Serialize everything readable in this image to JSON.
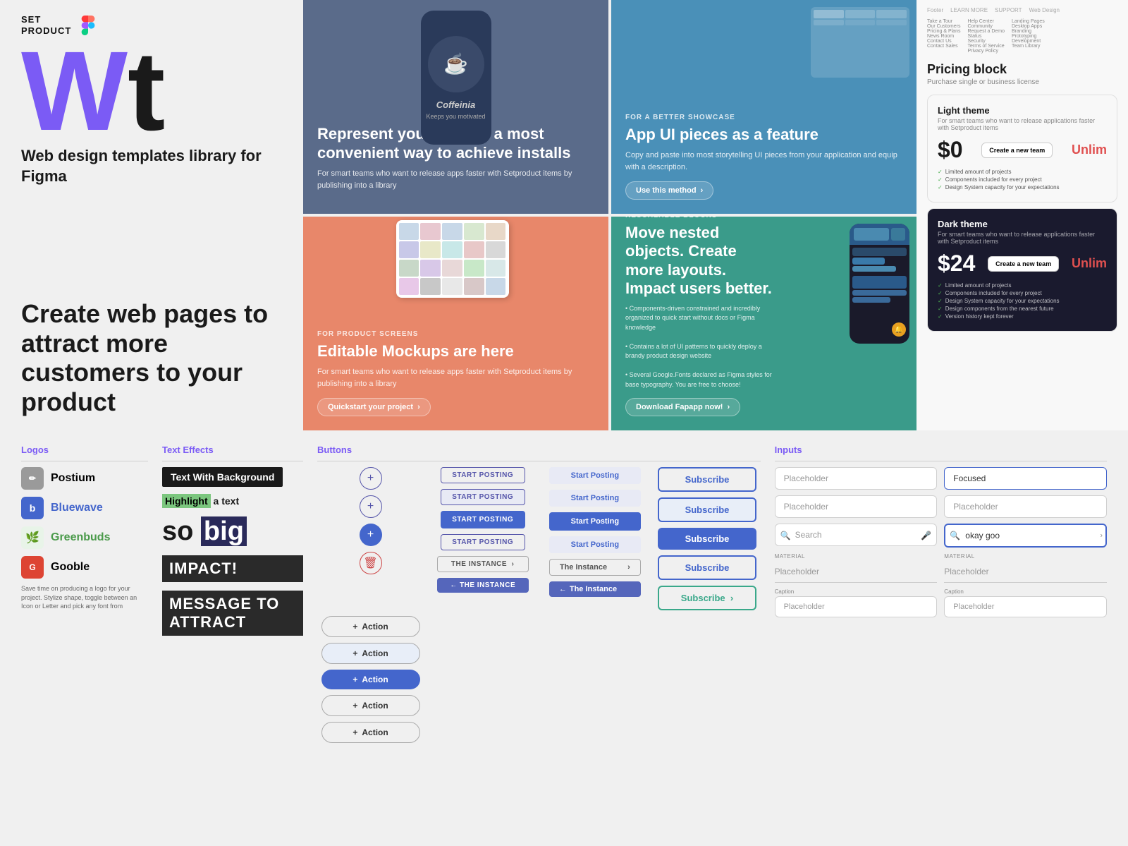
{
  "brand": {
    "name_line1": "SET",
    "name_line2": "PRODUCT",
    "hero_w": "W",
    "hero_t": "t",
    "subtitle": "Web design templates library for Figma",
    "cta": "Create web pages to attract more customers to your product"
  },
  "cards": [
    {
      "id": "card-1",
      "bg": "#5a6b8a",
      "label": "",
      "title": "Represent your apps in a most convenient way to achieve installs",
      "desc": "For smart teams who want to release apps faster with Setproduct items by publishing into a library",
      "img_text": "Coffeinia",
      "img_sub": "Keeps you motivated",
      "btn_label": ""
    },
    {
      "id": "card-2",
      "bg": "#4a90b8",
      "label": "FOR A BETTER SHOWCASE",
      "title": "App UI pieces as a feature",
      "desc": "Copy and paste into most storytelling UI pieces from your application and equip with a description.",
      "btn_label": "Use this method  ›"
    },
    {
      "id": "card-3",
      "bg": "#e8876a",
      "label": "FOR PRODUCT SCREENS",
      "title": "Editable Mockups are here",
      "desc": "For smart teams who want to release apps faster with Setproduct items by publishing into a library",
      "btn_label": "Quickstart your project  ›"
    },
    {
      "id": "card-4",
      "bg": "#3a9b8a",
      "label": "RESCALABLE BLOCKS",
      "title": "Move nested objects. Create more layouts. Impact users better.",
      "desc": "• Components-driven constrained and incredibly organized to quick start without docs or Figma knowledge\n• Contains a lot of UI patterns to quickly deploy a brandy product design website\n• Several Google.Fonts declared as Figma styles for base typography. You are free to choose!",
      "btn_label": "Download Fapapp now!  ›"
    }
  ],
  "pricing": {
    "header": "Pricing block",
    "sub": "Purchase single or business license",
    "light_theme": {
      "title": "Light theme",
      "desc": "For smart teams who want to release applications faster with Setproduct items",
      "price": "$0",
      "cta": "Create a new team",
      "unlimited": "Unlim",
      "features": [
        "Limited amount of projects",
        "Components included for every project",
        "Design System capacity for your expectations"
      ]
    },
    "dark_theme": {
      "title": "Dark theme",
      "desc": "For smart teams who want to release applications faster with Setproduct items",
      "price": "$24",
      "cta": "Create a new team",
      "unlimited": "Unlim",
      "features": [
        "Limited amount of projects",
        "Components included for every project",
        "Design System capacity for your expectations",
        "Design components from the nearest future",
        "Version history kept forever"
      ]
    }
  },
  "sections": {
    "logos": {
      "title": "Logos",
      "items": [
        {
          "name": "Postium",
          "icon_char": "✏",
          "icon_bg": "#aaa"
        },
        {
          "name": "Bluewave",
          "icon_char": "b",
          "icon_bg": "#4466cc"
        },
        {
          "name": "Greenbuds",
          "icon_char": "🌿",
          "icon_bg": "#e8f4e8"
        },
        {
          "name": "Gooble",
          "icon_char": "G",
          "icon_bg": "#dd4433"
        }
      ],
      "desc": "Save time on producing a logo for your project. Stylize shape, toggle between an Icon or Letter and pick any font from"
    },
    "text_effects": {
      "title": "Text Effects",
      "items": [
        {
          "type": "bg",
          "text": "Text With Background"
        },
        {
          "type": "highlight",
          "text1": "Highlight",
          "text2": " a text"
        },
        {
          "type": "big",
          "text1": "so",
          "text2": "big"
        },
        {
          "type": "impact",
          "text": "Impact!"
        },
        {
          "type": "impact2",
          "text": "message to attract"
        }
      ]
    },
    "buttons": {
      "title": "Buttons",
      "col1_plus": "+",
      "col1_items": [
        {
          "type": "circle_plus"
        },
        {
          "type": "circle_plus"
        },
        {
          "type": "circle_plus_filled"
        },
        {
          "type": "circle_delete"
        }
      ],
      "col2_items": [
        "START POSTING",
        "START POSTING",
        "START POSTING",
        "START POSTING",
        "THE INSTANCE  ›",
        "← THE INSTANCE"
      ],
      "col3_items": [
        "Start Posting",
        "Start Posting",
        "Start Posting",
        "Start Posting",
        "The Instance  ›",
        "← The Instance"
      ],
      "col4_items": [
        "Subscribe",
        "Subscribe",
        "Subscribe",
        "Subscribe",
        "Subscribe  ›"
      ],
      "col5_items": [
        "+ Action",
        "+ Action",
        "+ Action",
        "+ Action",
        "+ Action"
      ]
    },
    "inputs": {
      "title": "Inputs",
      "items": [
        {
          "type": "text",
          "placeholder": "Placeholder",
          "state": "default"
        },
        {
          "type": "text",
          "placeholder": "Focused",
          "state": "focused"
        },
        {
          "type": "text",
          "placeholder": "Placeholder",
          "state": "default"
        },
        {
          "type": "text",
          "placeholder": "Placeholder",
          "state": "default"
        },
        {
          "type": "search",
          "placeholder": "Search",
          "state": "default"
        },
        {
          "type": "search_typed",
          "value": "okay goo",
          "state": "typed"
        },
        {
          "type": "material",
          "label": "MATERIAL",
          "placeholder": "Placeholder"
        },
        {
          "type": "material",
          "label": "MATERIAL",
          "placeholder": "Placeholder"
        },
        {
          "type": "caption",
          "label": "Caption",
          "placeholder": "Placeholder"
        },
        {
          "type": "caption",
          "label": "Caption",
          "placeholder": "Placeholder"
        }
      ]
    }
  }
}
